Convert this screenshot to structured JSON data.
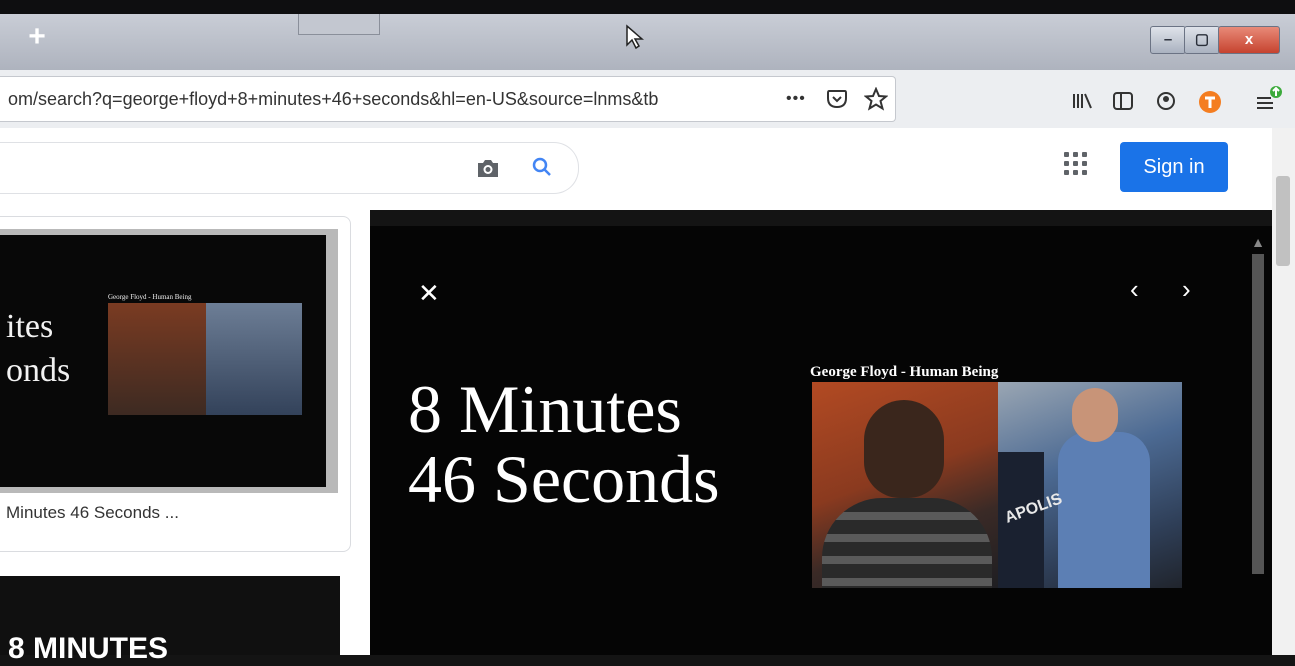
{
  "browser": {
    "new_tab_symbol": "+",
    "url": "om/search?q=george+floyd+8+minutes+46+seconds&hl=en-US&source=lnms&tb",
    "page_actions_symbol": "•••",
    "window_controls": {
      "minimize": "–",
      "maximize": "▢",
      "close": "x"
    }
  },
  "google": {
    "sign_in_label": "Sign in",
    "accent_color": "#1a73e8"
  },
  "results": {
    "thumb_text": "ites\nonds",
    "thumb_caption": "George Floyd - Human Being",
    "card_title": "Minutes 46 Seconds ...",
    "next_card_text": "8 MINUTES"
  },
  "viewer": {
    "close_symbol": "✕",
    "prev_symbol": "‹",
    "next_symbol": "›",
    "title_line1": "8 Minutes",
    "title_line2": "46 Seconds",
    "image_caption": "George Floyd - Human Being",
    "door_text": "APOLIS"
  }
}
